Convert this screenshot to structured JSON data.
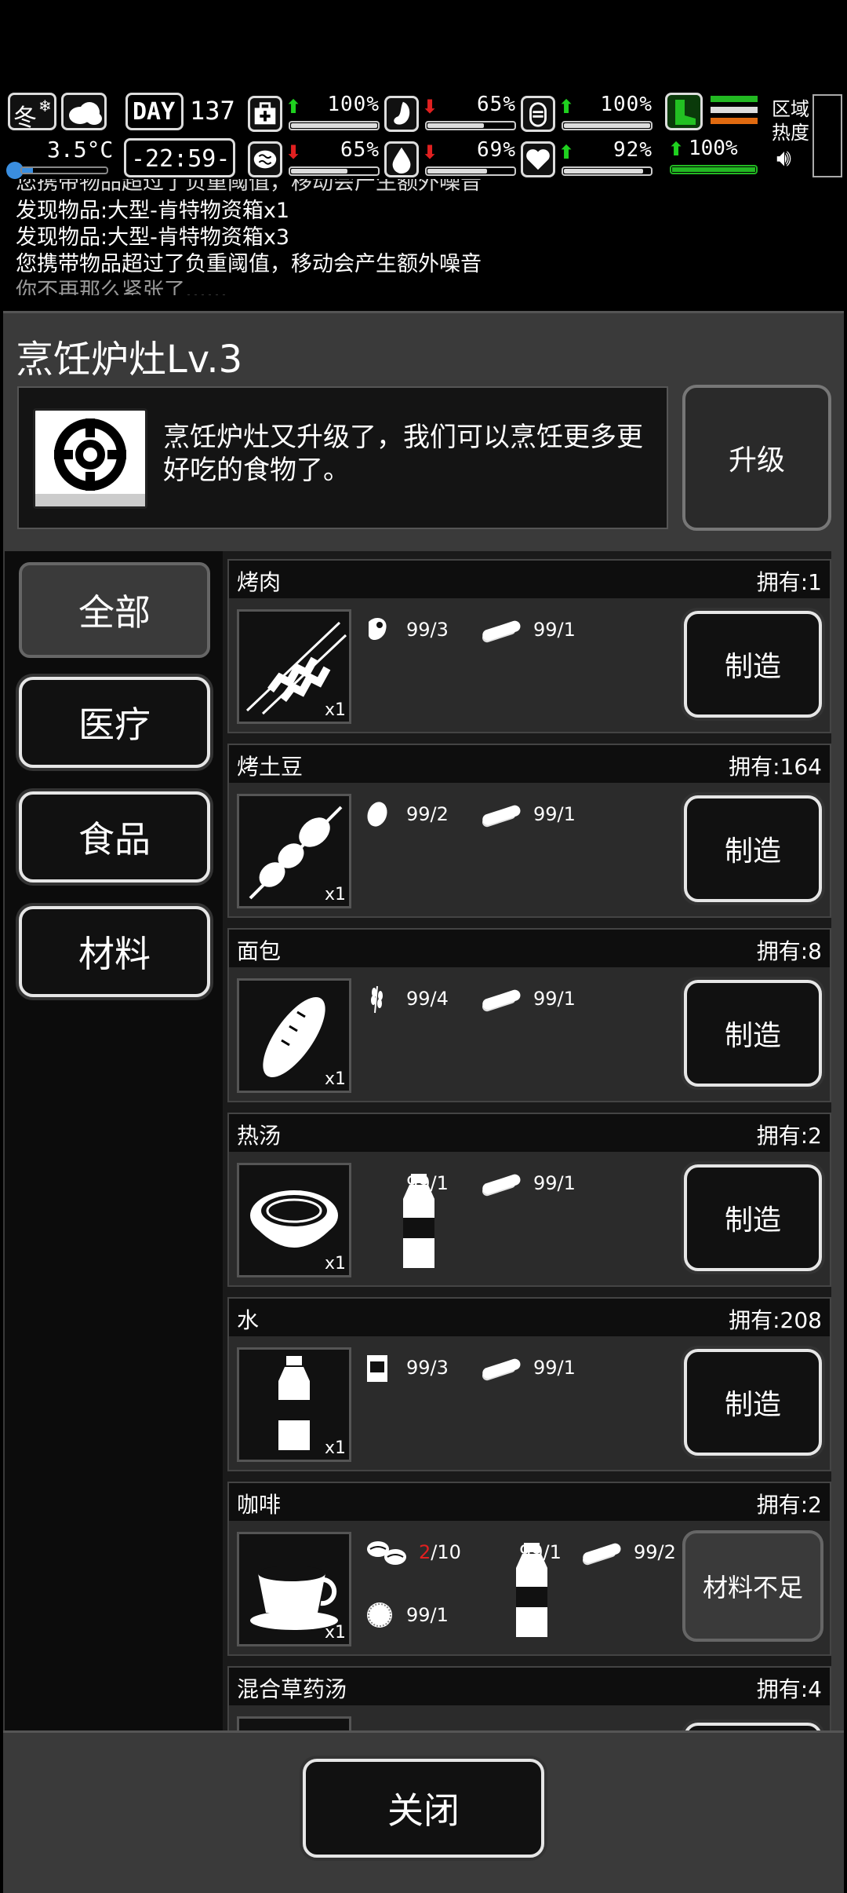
{
  "hud": {
    "season": "冬",
    "temperature": "3.5°C",
    "day_label": "DAY",
    "day_number": "137",
    "clock": "-22:59-",
    "stats": [
      {
        "icon": "medkit-icon",
        "trend": "up",
        "value": "100%",
        "fill": 1.0
      },
      {
        "icon": "stomach-icon",
        "trend": "down",
        "value": "65%",
        "fill": 0.65
      },
      {
        "icon": "stamina-icon",
        "trend": "up",
        "value": "100%",
        "fill": 1.0
      },
      {
        "icon": "brain-icon",
        "trend": "down",
        "value": "65%",
        "fill": 0.65
      },
      {
        "icon": "water-drop-icon",
        "trend": "down",
        "value": "69%",
        "fill": 0.69
      },
      {
        "icon": "heart-icon",
        "trend": "up",
        "value": "92%",
        "fill": 0.92
      }
    ],
    "boot_value": "100%",
    "boot_fill": 1.0,
    "zone_heat_label": "区域\n热度",
    "colors": {
      "up": "#1fd11f",
      "down": "#e02020",
      "heat_green": "#22b822",
      "heat_orange": "#e06a10",
      "temp_blue": "#3a8ee0"
    }
  },
  "log": [
    "您携带物品超过了负重阈值，移动会产生额外噪音",
    "发现物品:大型-肯特物资箱x1",
    "发现物品:大型-肯特物资箱x3",
    "您携带物品超过了负重阈值，移动会产生额外噪音",
    "你不再那么紧张了……"
  ],
  "station": {
    "title": "烹饪炉灶Lv.3",
    "description": "烹饪炉灶又升级了，我们可以烹饪更多更好吃的食物了。",
    "upgrade_label": "升级"
  },
  "categories": [
    {
      "label": "全部",
      "active": true
    },
    {
      "label": "医疗",
      "active": false
    },
    {
      "label": "食品",
      "active": false
    },
    {
      "label": "材料",
      "active": false
    }
  ],
  "recipes": [
    {
      "name": "烤肉",
      "owned": "拥有:1",
      "qty": "x1",
      "icon": "skewer-meat-icon",
      "materials": [
        {
          "icon": "raw-meat-icon",
          "have": "99",
          "need": "/3",
          "short": false
        },
        {
          "icon": "firewood-icon",
          "have": "99",
          "need": "/1",
          "short": false
        }
      ],
      "action": "制造",
      "enabled": true
    },
    {
      "name": "烤土豆",
      "owned": "拥有:164",
      "qty": "x1",
      "icon": "skewer-potato-icon",
      "materials": [
        {
          "icon": "potato-icon",
          "have": "99",
          "need": "/2",
          "short": false
        },
        {
          "icon": "firewood-icon",
          "have": "99",
          "need": "/1",
          "short": false
        }
      ],
      "action": "制造",
      "enabled": true
    },
    {
      "name": "面包",
      "owned": "拥有:8",
      "qty": "x1",
      "icon": "bread-icon",
      "materials": [
        {
          "icon": "wheat-icon",
          "have": "99",
          "need": "/4",
          "short": false
        },
        {
          "icon": "firewood-icon",
          "have": "99",
          "need": "/1",
          "short": false
        }
      ],
      "action": "制造",
      "enabled": true
    },
    {
      "name": "热汤",
      "owned": "拥有:2",
      "qty": "x1",
      "icon": "soup-bowl-icon",
      "materials": [
        {
          "icon": "water-bottle-icon",
          "have": "99",
          "need": "/1",
          "short": false
        },
        {
          "icon": "firewood-icon",
          "have": "99",
          "need": "/1",
          "short": false
        }
      ],
      "action": "制造",
      "enabled": true
    },
    {
      "name": "水",
      "owned": "拥有:208",
      "qty": "x1",
      "icon": "water-bottle-icon",
      "materials": [
        {
          "icon": "water-can-icon",
          "have": "99",
          "need": "/3",
          "short": false
        },
        {
          "icon": "firewood-icon",
          "have": "99",
          "need": "/1",
          "short": false
        }
      ],
      "action": "制造",
      "enabled": true
    },
    {
      "name": "咖啡",
      "owned": "拥有:2",
      "qty": "x1",
      "icon": "coffee-cup-icon",
      "materials": [
        {
          "icon": "coffee-beans-icon",
          "have": "2",
          "need": "/10",
          "short": true
        },
        {
          "icon": "water-bottle-icon",
          "have": "99",
          "need": "/1",
          "short": false
        },
        {
          "icon": "firewood-icon",
          "have": "99",
          "need": "/2",
          "short": false
        },
        {
          "icon": "filter-icon",
          "have": "99",
          "need": "/1",
          "short": false
        }
      ],
      "action": "材料不足",
      "enabled": false
    },
    {
      "name": "混合草药汤",
      "owned": "拥有:4",
      "qty": "",
      "icon": "herb-soup-icon",
      "materials": [],
      "action": "",
      "enabled": true
    }
  ],
  "close_label": "关闭"
}
